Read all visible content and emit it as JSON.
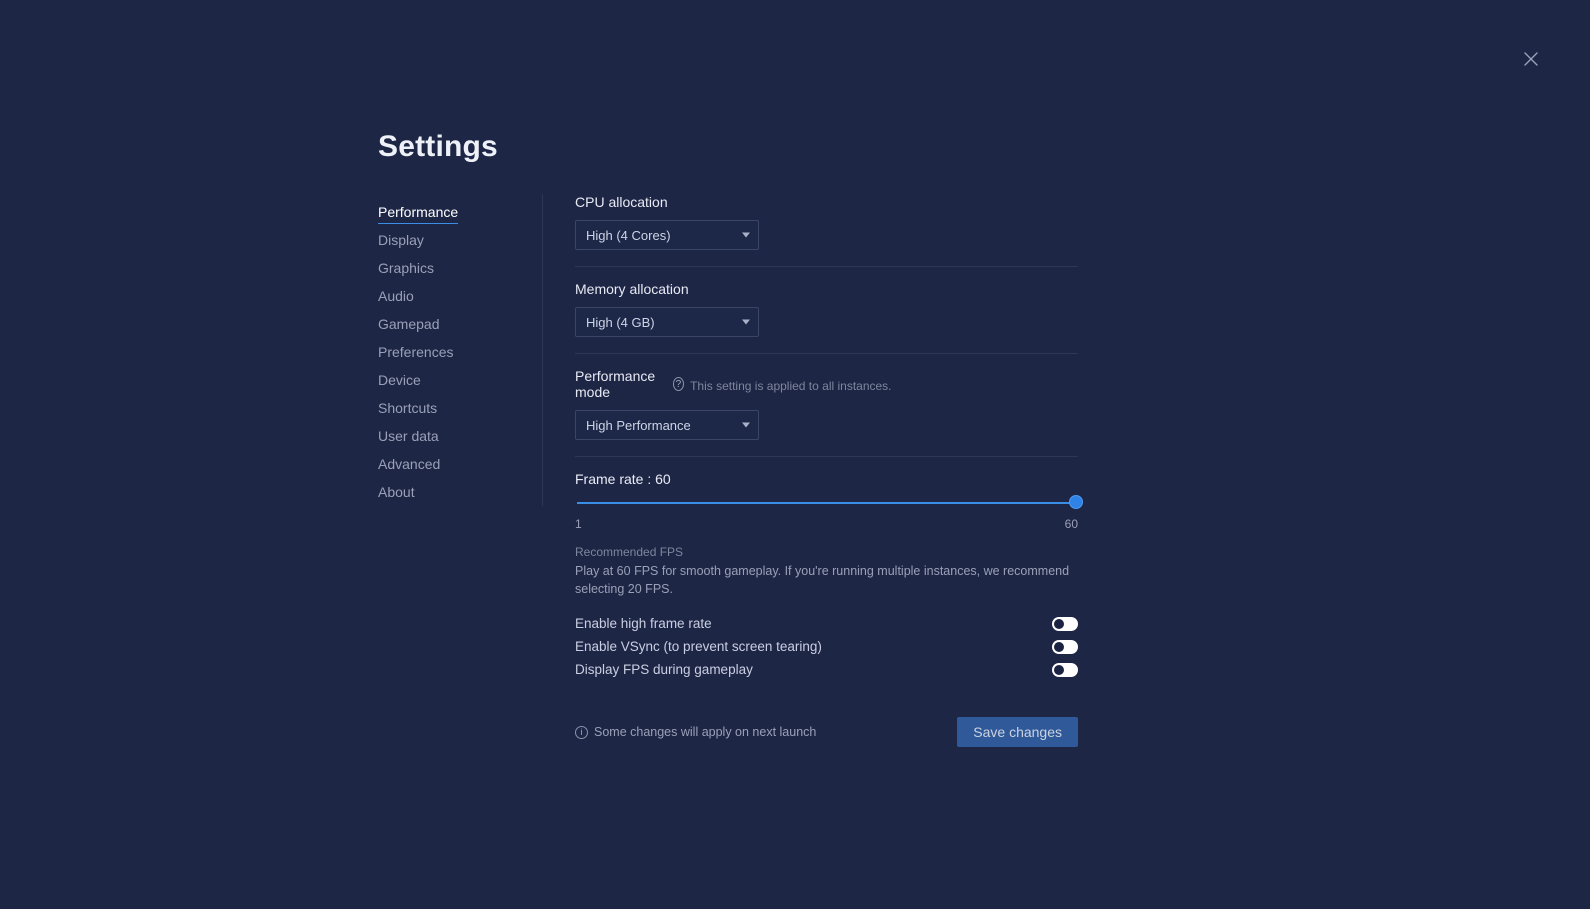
{
  "title": "Settings",
  "sidebar": {
    "items": [
      {
        "label": "Performance",
        "active": true
      },
      {
        "label": "Display"
      },
      {
        "label": "Graphics"
      },
      {
        "label": "Audio"
      },
      {
        "label": "Gamepad"
      },
      {
        "label": "Preferences"
      },
      {
        "label": "Device"
      },
      {
        "label": "Shortcuts"
      },
      {
        "label": "User data"
      },
      {
        "label": "Advanced"
      },
      {
        "label": "About"
      }
    ]
  },
  "cpu": {
    "label": "CPU allocation",
    "value": "High (4 Cores)"
  },
  "memory": {
    "label": "Memory allocation",
    "value": "High (4 GB)"
  },
  "perfmode": {
    "label": "Performance mode",
    "sublabel": "This setting is applied to all instances.",
    "value": "High Performance"
  },
  "framerate": {
    "label_prefix": "Frame rate : ",
    "value": 60,
    "min": 1,
    "max": 60,
    "rec_title": "Recommended FPS",
    "rec_body": "Play at 60 FPS for smooth gameplay. If you're running multiple instances, we recommend selecting 20 FPS."
  },
  "toggles": {
    "highfps": {
      "label": "Enable high frame rate",
      "on": false
    },
    "vsync": {
      "label": "Enable VSync (to prevent screen tearing)",
      "on": false
    },
    "showfps": {
      "label": "Display FPS during gameplay",
      "on": false
    }
  },
  "footer": {
    "note": "Some changes will apply on next launch",
    "save": "Save changes"
  }
}
